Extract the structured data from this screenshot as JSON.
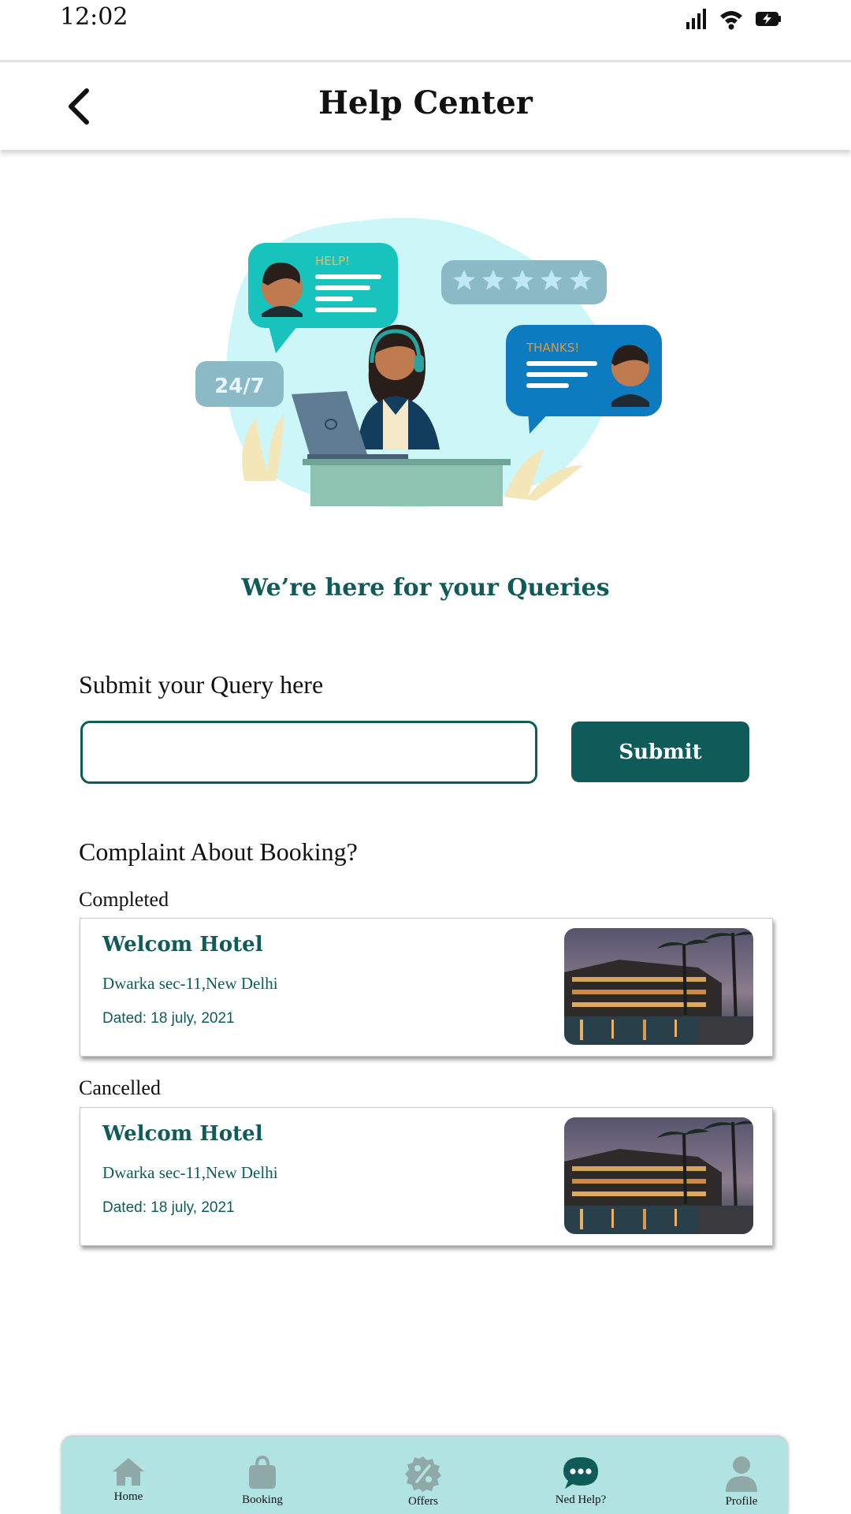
{
  "status_bar": {
    "time": "12:02",
    "icons": [
      "signal-icon",
      "wifi-icon",
      "battery-charging-icon"
    ]
  },
  "header": {
    "title": "Help Center",
    "back_icon": "chevron-left-icon"
  },
  "hero": {
    "bubble_help_text": "HELP!",
    "bubble_thanks_text": "THANKS!",
    "badge_text": "24/7",
    "rating_stars": 5
  },
  "tagline": "We’re here for your  Queries",
  "query": {
    "label": "Submit your Query here",
    "value": "",
    "placeholder": "",
    "submit_label": "Submit"
  },
  "complaints": {
    "title": "Complaint About Booking?",
    "sections": [
      {
        "label": "Completed",
        "hotel_name": "Welcom Hotel",
        "address": "Dwarka sec-11,New Delhi",
        "date": "Dated: 18 july, 2021"
      },
      {
        "label": "Cancelled",
        "hotel_name": "Welcom Hotel",
        "address": "Dwarka sec-11,New Delhi",
        "date": "Dated: 18 july, 2021"
      }
    ]
  },
  "bottom_nav": {
    "items": [
      {
        "label": "Home",
        "icon": "home-icon"
      },
      {
        "label": "Booking",
        "icon": "shopping-bag-icon"
      },
      {
        "label": "Offers",
        "icon": "percent-badge-icon"
      },
      {
        "label": "Ned Help?",
        "icon": "chat-bubble-icon",
        "active": true
      },
      {
        "label": "Profile",
        "icon": "user-icon"
      }
    ]
  },
  "colors": {
    "primary": "#0e5b59",
    "nav_background": "#b2e3e3",
    "nav_icon_inactive": "#8fa9a8",
    "nav_icon_active": "#0e5b59"
  }
}
